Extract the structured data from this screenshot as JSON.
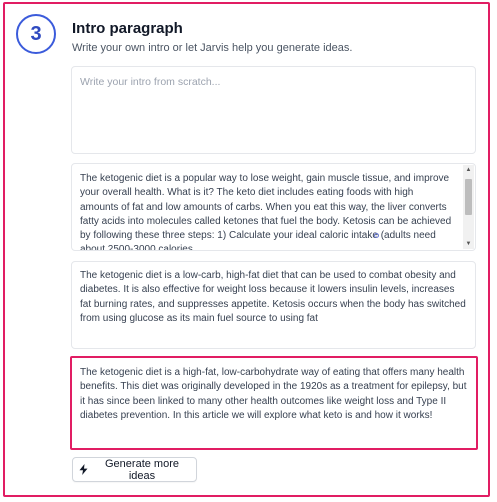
{
  "step": {
    "number": "3"
  },
  "header": {
    "title": "Intro paragraph",
    "subtitle": "Write your own intro or let Jarvis help you generate ideas."
  },
  "intro_input": {
    "value": "",
    "placeholder": "Write your intro from scratch..."
  },
  "ideas": [
    {
      "text": "The ketogenic diet is a popular way to lose weight, gain muscle tissue, and improve your overall health. What is it? The keto diet includes eating foods with high amounts of fat and low amounts of carbs. When you eat this way, the liver converts fatty acids into molecules called ketones that fuel the body. Ketosis can be achieved by following these three steps: 1) Calculate your ideal caloric intake (adults need about 2500-3000 calories"
    },
    {
      "text": "The ketogenic diet is a low-carb, high-fat diet that can be used to combat obesity and diabetes. It is also effective for weight loss because it lowers insulin levels, increases fat burning rates, and suppresses appetite. Ketosis occurs when the body has switched from using glucose as its main fuel source to using fat"
    },
    {
      "text": "The ketogenic diet is a high-fat, low-carbohydrate way of eating that offers many health benefits. This diet was originally developed in the 1920s as a treatment for epilepsy, but it has since been linked to many other health outcomes like weight loss and Type II diabetes prevention. In this article we will explore what keto is and how it works!"
    }
  ],
  "actions": {
    "generate_label": "Generate more ideas"
  },
  "icons": {
    "generate": "lightning-bolt-icon",
    "scroll_up": "triangle-up-icon",
    "scroll_down": "triangle-down-icon"
  },
  "colors": {
    "highlight_border": "#e11d63",
    "step_badge": "#3b5bdb"
  }
}
